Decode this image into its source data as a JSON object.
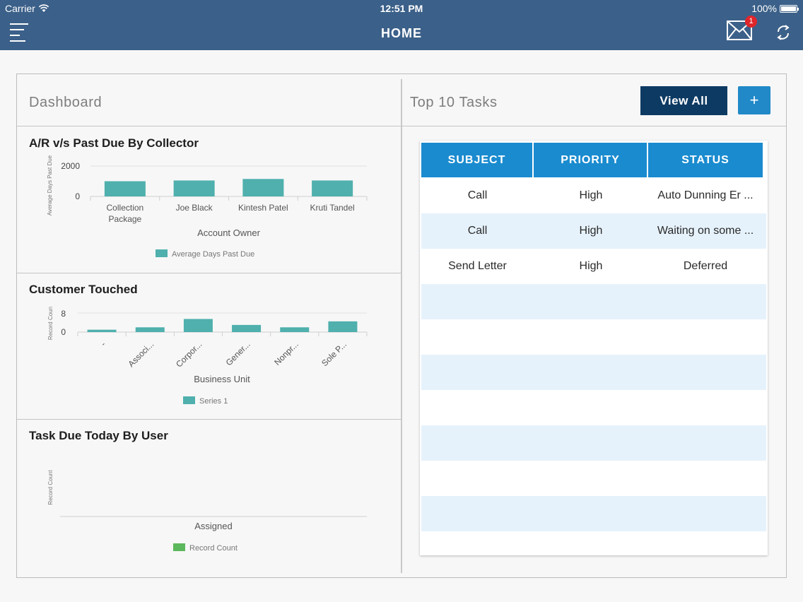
{
  "status_bar": {
    "carrier": "Carrier",
    "time": "12:51 PM",
    "battery": "100%"
  },
  "header": {
    "title": "HOME",
    "mail_badge": "1"
  },
  "dashboard": {
    "title": "Dashboard"
  },
  "tasks": {
    "title": "Top 10 Tasks",
    "view_all_label": "View All",
    "add_label": "+",
    "columns": [
      "SUBJECT",
      "PRIORITY",
      "STATUS"
    ],
    "rows": [
      {
        "subject": "Call",
        "priority": "High",
        "status": "Auto Dunning Er ..."
      },
      {
        "subject": "Call",
        "priority": "High",
        "status": "Waiting on some ..."
      },
      {
        "subject": "Send Letter",
        "priority": "High",
        "status": "Deferred"
      }
    ]
  },
  "colors": {
    "header": "#3b6089",
    "bar": "#4fb0ad",
    "legend_green": "#5cb85c",
    "table_header": "#1a8bcf",
    "view_all": "#0d3a63",
    "add": "#2189c8"
  },
  "chart_data": [
    {
      "type": "bar",
      "title": "A/R v/s Past Due By Collector",
      "categories": [
        "Collection Package",
        "Joe Black",
        "Kintesh Patel",
        "Kruti Tandel"
      ],
      "series": [
        {
          "name": "Average Days Past Due",
          "values": [
            1000,
            1050,
            1150,
            1050
          ]
        }
      ],
      "xlabel": "Account Owner",
      "ylabel": "Average Days Past Due",
      "ylim": [
        0,
        2000
      ],
      "yticks": [
        "2000",
        "0"
      ],
      "legend": "bottom"
    },
    {
      "type": "bar",
      "title": "Customer Touched",
      "categories": [
        "-",
        "Associ...",
        "Corpor...",
        "Gener...",
        "Nonpr...",
        "Sole P..."
      ],
      "series": [
        {
          "name": "Series 1",
          "values": [
            1,
            2,
            5.5,
            3,
            2,
            4.5
          ]
        }
      ],
      "xlabel": "Business Unit",
      "ylabel": "Record Coun",
      "ylim": [
        0,
        8
      ],
      "yticks": [
        "8",
        "0"
      ],
      "legend": "bottom"
    },
    {
      "type": "bar",
      "title": "Task Due Today By User",
      "categories": [],
      "series": [
        {
          "name": "Record Count",
          "values": []
        }
      ],
      "xlabel": "Assigned",
      "ylabel": "Record Count",
      "legend": "bottom"
    }
  ]
}
